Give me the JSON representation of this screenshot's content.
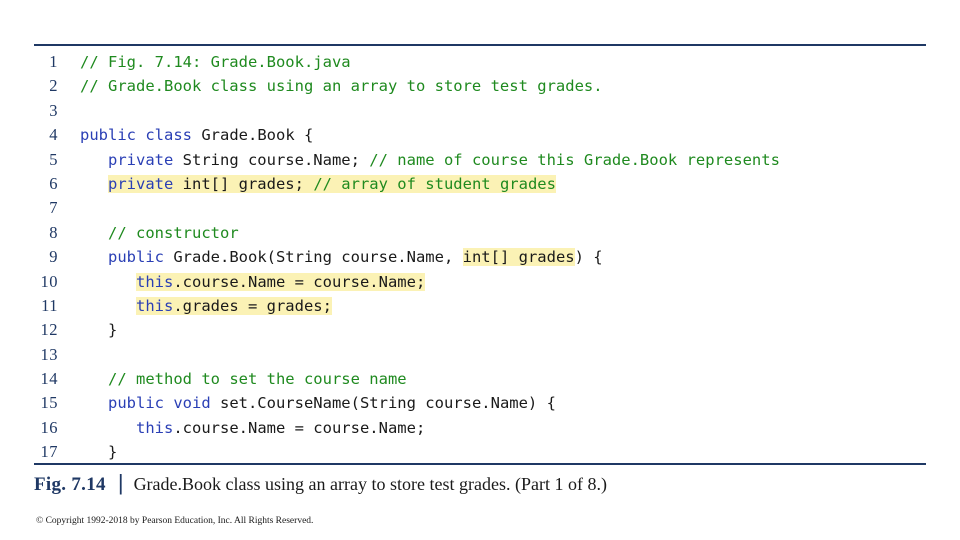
{
  "slide": {
    "caption": {
      "figure_number": "Fig. 7.14",
      "separator": "|",
      "text": "Grade.Book class using an array to store test grades. (Part 1 of 8.)"
    },
    "copyright": "© Copyright 1992-2018 by Pearson Education, Inc. All Rights Reserved.",
    "accent_color": "#1f3864",
    "highlight_color": "#fbf2b5",
    "comment_color": "#1f8a1f",
    "keyword_color": "#2a3fb5"
  },
  "code": {
    "lines": [
      {
        "number": "1",
        "tokens": [
          {
            "text": "// Fig. 7.14: Grade.Book.java",
            "style": "cmt",
            "hl": false
          }
        ]
      },
      {
        "number": "2",
        "tokens": [
          {
            "text": "// Grade.Book class using an array to store test grades.",
            "style": "cmt",
            "hl": false
          }
        ]
      },
      {
        "number": "3",
        "tokens": []
      },
      {
        "number": "4",
        "tokens": [
          {
            "text": "public class ",
            "style": "kw",
            "hl": false
          },
          {
            "text": "Grade.Book {",
            "style": "plain",
            "hl": false
          }
        ]
      },
      {
        "number": "5",
        "tokens": [
          {
            "text": "   ",
            "style": "plain",
            "hl": false
          },
          {
            "text": "private ",
            "style": "kw",
            "hl": false
          },
          {
            "text": "String course.Name; ",
            "style": "plain",
            "hl": false
          },
          {
            "text": "// name of course this Grade.Book represents",
            "style": "cmt",
            "hl": false
          }
        ]
      },
      {
        "number": "6",
        "tokens": [
          {
            "text": "   ",
            "style": "plain",
            "hl": false
          },
          {
            "text": "private ",
            "style": "kw",
            "hl": true
          },
          {
            "text": "int[] grades; ",
            "style": "plain",
            "hl": true
          },
          {
            "text": "// array of student grades",
            "style": "cmt",
            "hl": true
          }
        ]
      },
      {
        "number": "7",
        "tokens": []
      },
      {
        "number": "8",
        "tokens": [
          {
            "text": "   ",
            "style": "plain",
            "hl": false
          },
          {
            "text": "// constructor",
            "style": "cmt",
            "hl": false
          }
        ]
      },
      {
        "number": "9",
        "tokens": [
          {
            "text": "   ",
            "style": "plain",
            "hl": false
          },
          {
            "text": "public ",
            "style": "kw",
            "hl": false
          },
          {
            "text": "Grade.Book(String course.Name, ",
            "style": "plain",
            "hl": false
          },
          {
            "text": "int[] grades",
            "style": "plain",
            "hl": true
          },
          {
            "text": ") {",
            "style": "plain",
            "hl": false
          }
        ]
      },
      {
        "number": "10",
        "tokens": [
          {
            "text": "      ",
            "style": "plain",
            "hl": false
          },
          {
            "text": "this",
            "style": "kw",
            "hl": true
          },
          {
            "text": ".course.Name = course.Name;",
            "style": "plain",
            "hl": true
          }
        ]
      },
      {
        "number": "11",
        "tokens": [
          {
            "text": "      ",
            "style": "plain",
            "hl": false
          },
          {
            "text": "this",
            "style": "kw",
            "hl": true
          },
          {
            "text": ".grades = grades;",
            "style": "plain",
            "hl": true
          }
        ]
      },
      {
        "number": "12",
        "tokens": [
          {
            "text": "   }",
            "style": "plain",
            "hl": false
          }
        ]
      },
      {
        "number": "13",
        "tokens": []
      },
      {
        "number": "14",
        "tokens": [
          {
            "text": "   ",
            "style": "plain",
            "hl": false
          },
          {
            "text": "// method to set the course name",
            "style": "cmt",
            "hl": false
          }
        ]
      },
      {
        "number": "15",
        "tokens": [
          {
            "text": "   ",
            "style": "plain",
            "hl": false
          },
          {
            "text": "public void ",
            "style": "kw",
            "hl": false
          },
          {
            "text": "set.CourseName(String course.Name) {",
            "style": "plain",
            "hl": false
          }
        ]
      },
      {
        "number": "16",
        "tokens": [
          {
            "text": "      ",
            "style": "plain",
            "hl": false
          },
          {
            "text": "this",
            "style": "kw",
            "hl": false
          },
          {
            "text": ".course.Name = course.Name;",
            "style": "plain",
            "hl": false
          }
        ]
      },
      {
        "number": "17",
        "tokens": [
          {
            "text": "   }",
            "style": "plain",
            "hl": false
          }
        ]
      }
    ]
  }
}
